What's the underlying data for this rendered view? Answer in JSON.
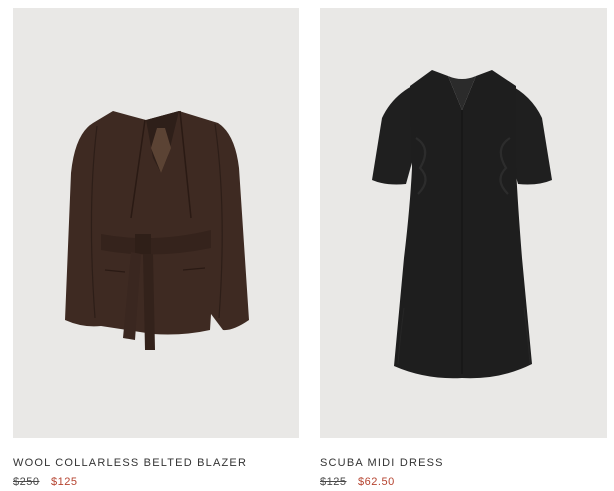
{
  "products": [
    {
      "name": "WOOL COLLARLESS BELTED BLAZER",
      "original_price": "$250",
      "sale_price": "$125",
      "image_icon": "brown-belted-blazer-image",
      "garment_color": "#3e2a22"
    },
    {
      "name": "SCUBA MIDI DRESS",
      "original_price": "$125",
      "sale_price": "$62.50",
      "image_icon": "black-midi-dress-image",
      "garment_color": "#1e1e1e"
    }
  ],
  "colors": {
    "photo_background": "#e9e8e6",
    "sale_price": "#b5432f",
    "text": "#333333"
  }
}
